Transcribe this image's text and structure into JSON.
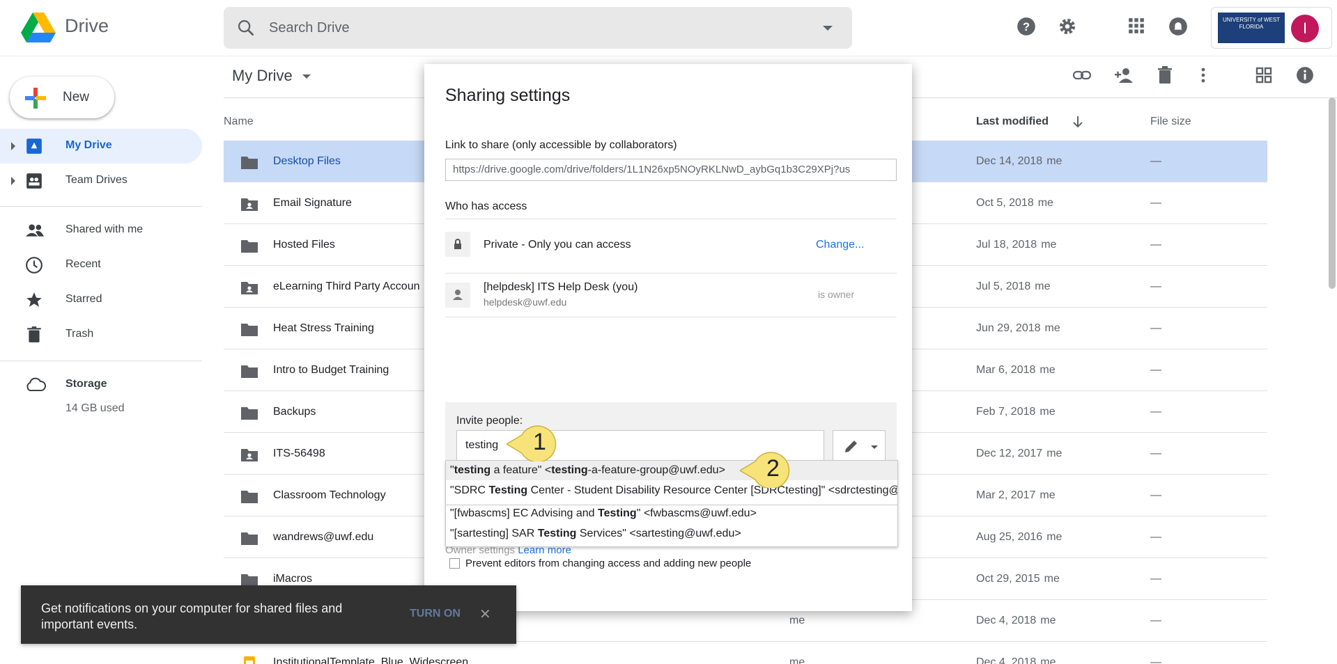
{
  "app": {
    "name": "Drive",
    "search_placeholder": "Search Drive",
    "account_avatar_letter": "I",
    "brand_logo_text": "UNIVERSITY of WEST FLORIDA"
  },
  "sidebar": {
    "new_label": "New",
    "items": [
      {
        "label": "My Drive",
        "icon": "my-drive-icon",
        "active": true
      },
      {
        "label": "Team Drives",
        "icon": "team-drives-icon"
      },
      {
        "label": "Shared with me",
        "icon": "people-icon"
      },
      {
        "label": "Recent",
        "icon": "clock-icon"
      },
      {
        "label": "Starred",
        "icon": "star-icon"
      },
      {
        "label": "Trash",
        "icon": "trash-icon"
      },
      {
        "label": "Storage",
        "icon": "cloud-icon"
      }
    ],
    "storage_used": "14 GB used"
  },
  "main": {
    "title": "My Drive",
    "columns": {
      "name": "Name",
      "last_modified": "Last modified",
      "file_size": "File size"
    },
    "files": [
      {
        "name": "Desktop Files",
        "date": "Dec 14, 2018",
        "by": "me",
        "size": "—",
        "shared": false,
        "selected": true
      },
      {
        "name": "Email Signature",
        "date": "Oct 5, 2018",
        "by": "me",
        "size": "—",
        "shared": true
      },
      {
        "name": "Hosted Files",
        "date": "Jul 18, 2018",
        "by": "me",
        "size": "—",
        "shared": false
      },
      {
        "name": "eLearning Third Party Accoun",
        "date": "Jul 5, 2018",
        "by": "me",
        "size": "—",
        "shared": true
      },
      {
        "name": "Heat Stress Training",
        "date": "Jun 29, 2018",
        "by": "me",
        "size": "—",
        "shared": false
      },
      {
        "name": "Intro to Budget Training",
        "date": "Mar 6, 2018",
        "by": "me",
        "size": "—",
        "shared": false
      },
      {
        "name": "Backups",
        "date": "Feb 7, 2018",
        "by": "me",
        "size": "—",
        "shared": false
      },
      {
        "name": "ITS-56498",
        "date": "Dec 12, 2017",
        "by": "me",
        "size": "—",
        "shared": true
      },
      {
        "name": "Classroom Technology",
        "date": "Mar 2, 2017",
        "by": "me",
        "size": "—",
        "shared": false
      },
      {
        "name": "wandrews@uwf.edu",
        "date": "Aug 25, 2016",
        "by": "me",
        "size": "—",
        "shared": false
      },
      {
        "name": "iMacros",
        "date": "Oct 29, 2015",
        "by": "me",
        "size": "—",
        "shared": false
      },
      {
        "name": "",
        "owner": "me",
        "date": "Dec 4, 2018",
        "by": "me",
        "size": "—",
        "shared": false
      },
      {
        "name": "InstitutionalTemplate_Blue_Widescreen",
        "owner": "me",
        "date": "Dec 4, 2018",
        "by": "me",
        "size": "—",
        "shared": false
      }
    ]
  },
  "dialog": {
    "title": "Sharing settings",
    "link_label": "Link to share (only accessible by collaborators)",
    "link_value": "https://drive.google.com/drive/folders/1L1N26xp5NOyRKLNwD_aybGq1b3C29XPj?us",
    "who_has_access": "Who has access",
    "access_private": "Private - Only you can access",
    "change_link": "Change...",
    "owner_name": "[helpdesk] ITS Help Desk (you)",
    "owner_email": "helpdesk@uwf.edu",
    "owner_role": "is owner",
    "invite_label": "Invite people:",
    "invite_value": "testing",
    "suggestions": [
      {
        "pre": "\"",
        "bold": "testing",
        "post": " a feature\" <",
        "bold2": "testing",
        "post2": "-a-feature-group@uwf.edu>"
      },
      {
        "pre": "\"SDRC ",
        "bold": "Testing",
        "post": " Center - Student Disability Resource Center [SDRCtesting]\" <sdrctesting@uwf.edu>",
        "bold2": "",
        "post2": ""
      },
      {
        "pre": "\"[fwbascms] EC Advising and ",
        "bold": "Testing",
        "post": "\" <fwbascms@uwf.edu>",
        "bold2": "",
        "post2": ""
      },
      {
        "pre": "\"[sartesting] SAR ",
        "bold": "Testing",
        "post": " Services\" <sartesting@uwf.edu>",
        "bold2": "",
        "post2": ""
      }
    ],
    "owner_settings": "Owner settings",
    "learn_more": "Learn more",
    "prevent_label": "Prevent editors from changing access and adding new people",
    "callout_1": "1",
    "callout_2": "2"
  },
  "toast": {
    "message": "Get notifications on your computer for shared files and important events.",
    "action": "TURN ON",
    "close": "✕"
  },
  "colors": {
    "accent": "#1a73e8",
    "selected_row": "#c6d9f7",
    "callout": "#f7e37a"
  }
}
